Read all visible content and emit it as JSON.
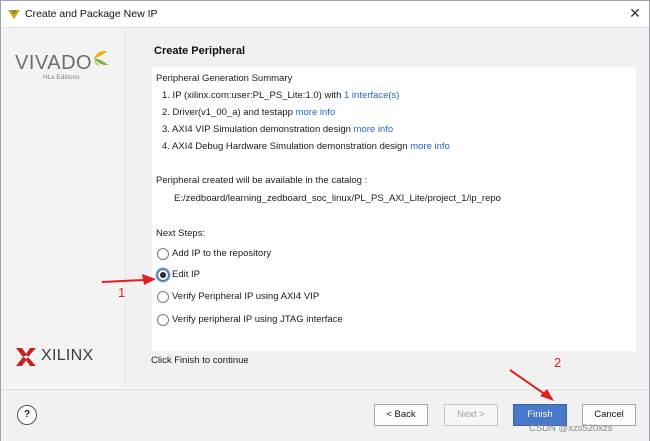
{
  "window": {
    "title": "Create and Package New IP",
    "close_glyph": "✕"
  },
  "left_pane": {
    "vivado_logo": {
      "word": "VIVADO",
      "edition": "HLx Editions",
      "icon": "vivado-leaf-icon"
    },
    "xilinx_logo": {
      "word": "XILINX",
      "icon": "xilinx-x-icon"
    }
  },
  "main": {
    "heading": "Create Peripheral",
    "summary_title": "Peripheral Generation Summary",
    "items": [
      {
        "text": "1. IP (xilinx.com:user:PL_PS_Lite:1.0) with ",
        "link": "1 interface(s)"
      },
      {
        "text": "2. Driver(v1_00_a) and testapp ",
        "link": "more info"
      },
      {
        "text": "3. AXI4 VIP Simulation demonstration design ",
        "link": "more info"
      },
      {
        "text": "4. AXI4 Debug Hardware Simulation demonstration design ",
        "link": "more info"
      }
    ],
    "catalog_note": "Peripheral created will be available in the catalog :",
    "catalog_path": "E:/zedboard/learning_zedboard_soc_linux/PL_PS_AXI_Lite/project_1/ip_repo",
    "next_steps_label": "Next Steps:",
    "options": [
      {
        "label": "Add IP to the repository",
        "selected": false
      },
      {
        "label": "Edit IP",
        "selected": true
      },
      {
        "label": "Verify Peripheral IP using AXI4 VIP",
        "selected": false
      },
      {
        "label": "Verify peripheral IP using JTAG interface",
        "selected": false
      }
    ],
    "finish_hint": "Click Finish to continue"
  },
  "footer": {
    "help_label": "?",
    "back_label": "< Back",
    "next_label": "Next >",
    "finish_label": "Finish",
    "cancel_label": "Cancel"
  },
  "annotations": {
    "step1": "1",
    "step2": "2",
    "color": "#e02020"
  },
  "watermark": "CSDN @xzs520xzs",
  "colors": {
    "link": "#2764c4",
    "primary_button": "#4a78c8",
    "left_pane": "#f3f3f3",
    "content_panel": "#ffffff"
  }
}
